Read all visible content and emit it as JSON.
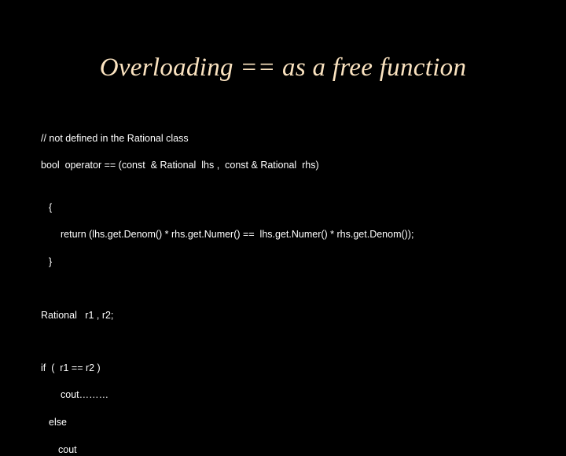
{
  "slide": {
    "title": "Overloading == as a free function",
    "title_color": "#fbe3c0",
    "background_color": "#000000",
    "text_color": "#ffffff",
    "code_lines": {
      "comment": "// not defined in the Rational class",
      "signature": "bool  operator == (const  & Rational  lhs ,  const & Rational  rhs)",
      "open_brace": "{",
      "return_stmt": "return (lhs.get.Denom() * rhs.get.Numer() ==  lhs.get.Numer() * rhs.get.Denom());",
      "close_brace": "}",
      "declaration": "Rational   r1 , r2;",
      "if_stmt": "if  (  r1 == r2 )",
      "cout_then": "cout………",
      "else_stmt": "else",
      "cout_else": "cout"
    }
  }
}
